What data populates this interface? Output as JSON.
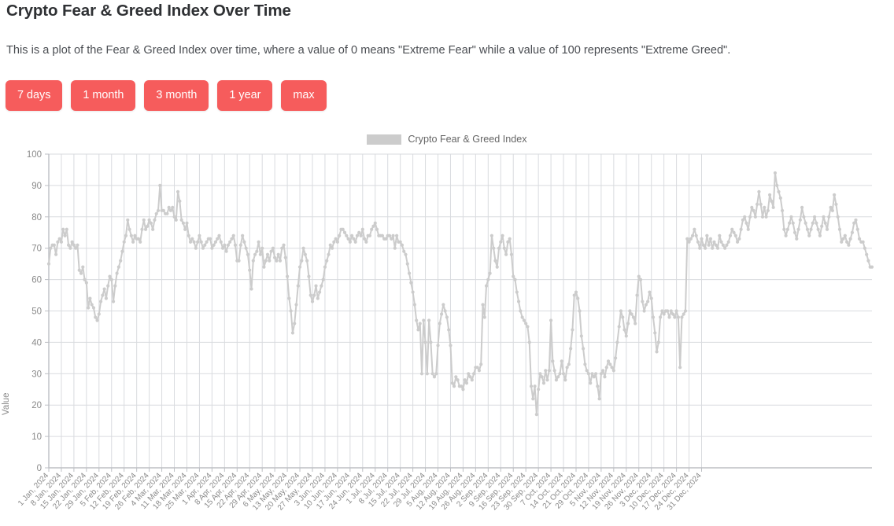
{
  "page": {
    "title": "Crypto Fear & Greed Index Over Time",
    "description": "This is a plot of the Fear & Greed Index over time, where a value of 0 means \"Extreme Fear\" while a value of 100 represents \"Extreme Greed\"."
  },
  "range_buttons": [
    {
      "label": "7 days"
    },
    {
      "label": "1 month"
    },
    {
      "label": "3 month"
    },
    {
      "label": "1 year"
    },
    {
      "label": "max"
    }
  ],
  "colors": {
    "button": "#f65c5c",
    "button_text": "#ffffff",
    "series": "#cccccc",
    "grid": "#d6d8dc",
    "axis_text": "#8a8a8a",
    "title_text": "#2f3134"
  },
  "chart_data": {
    "type": "line",
    "title": "",
    "xlabel": "",
    "ylabel": "Value",
    "ylim": [
      0,
      100
    ],
    "yticks": [
      0,
      10,
      20,
      30,
      40,
      50,
      60,
      70,
      80,
      90,
      100
    ],
    "grid": true,
    "legend_position": "top-center",
    "series": [
      {
        "name": "Crypto Fear & Greed Index",
        "color": "#cccccc",
        "marker": "circle",
        "values": [
          65,
          70,
          71,
          71,
          68,
          72,
          73,
          72,
          76,
          74,
          76,
          71,
          70,
          72,
          71,
          70,
          71,
          63,
          62,
          64,
          60,
          59,
          51,
          54,
          52,
          51,
          48,
          47,
          49,
          53,
          55,
          57,
          54,
          58,
          61,
          60,
          53,
          58,
          62,
          64,
          66,
          69,
          72,
          74,
          79,
          76,
          74,
          72,
          74,
          73,
          73,
          72,
          76,
          79,
          76,
          77,
          79,
          78,
          76,
          79,
          81,
          82,
          90,
          82,
          82,
          81,
          81,
          83,
          82,
          83,
          80,
          79,
          88,
          85,
          79,
          78,
          76,
          78,
          74,
          72,
          73,
          72,
          70,
          72,
          74,
          72,
          70,
          71,
          72,
          73,
          73,
          70,
          71,
          72,
          73,
          74,
          72,
          70,
          71,
          69,
          71,
          72,
          73,
          74,
          71,
          66,
          66,
          71,
          74,
          72,
          70,
          68,
          63,
          57,
          66,
          68,
          69,
          72,
          68,
          70,
          64,
          66,
          68,
          66,
          69,
          70,
          67,
          66,
          68,
          66,
          70,
          71,
          67,
          61,
          54,
          50,
          43,
          46,
          52,
          58,
          64,
          66,
          70,
          68,
          66,
          61,
          55,
          53,
          55,
          58,
          54,
          56,
          58,
          60,
          64,
          66,
          68,
          71,
          70,
          72,
          73,
          72,
          74,
          76,
          76,
          75,
          74,
          73,
          72,
          74,
          73,
          72,
          74,
          75,
          74,
          76,
          73,
          72,
          74,
          74,
          76,
          77,
          78,
          76,
          74,
          74,
          74,
          73,
          73,
          74,
          74,
          73,
          74,
          70,
          74,
          72,
          72,
          71,
          69,
          68,
          65,
          62,
          59,
          56,
          52,
          47,
          44,
          46,
          30,
          47,
          40,
          30,
          47,
          40,
          30,
          29,
          30,
          39,
          46,
          49,
          52,
          50,
          48,
          44,
          39,
          27,
          26,
          29,
          28,
          26,
          26,
          25,
          28,
          27,
          30,
          29,
          28,
          30,
          32,
          32,
          31,
          33,
          52,
          48,
          58,
          60,
          62,
          74,
          70,
          66,
          64,
          70,
          72,
          74,
          70,
          68,
          72,
          73,
          68,
          61,
          60,
          56,
          53,
          50,
          48,
          47,
          46,
          45,
          40,
          26,
          22,
          26,
          17,
          25,
          30,
          29,
          27,
          31,
          28,
          31,
          47,
          34,
          31,
          28,
          29,
          30,
          34,
          30,
          28,
          32,
          33,
          38,
          44,
          55,
          56,
          54,
          50,
          42,
          38,
          33,
          31,
          30,
          27,
          30,
          29,
          30,
          26,
          22,
          30,
          31,
          29,
          32,
          34,
          33,
          32,
          31,
          35,
          40,
          45,
          50,
          48,
          44,
          42,
          46,
          50,
          49,
          48,
          46,
          55,
          61,
          60,
          53,
          50,
          52,
          53,
          56,
          54,
          48,
          43,
          37,
          40,
          48,
          50,
          49,
          50,
          50,
          48,
          50,
          49,
          48,
          50,
          48,
          32,
          48,
          49,
          50,
          73,
          72,
          73,
          74,
          76,
          74,
          72,
          70,
          73,
          71,
          70,
          74,
          71,
          73,
          70,
          72,
          71,
          70,
          74,
          72,
          71,
          70,
          71,
          72,
          74,
          76,
          75,
          74,
          72,
          73,
          76,
          79,
          80,
          78,
          76,
          80,
          83,
          82,
          80,
          84,
          88,
          84,
          80,
          83,
          80,
          82,
          87,
          85,
          83,
          94,
          90,
          88,
          86,
          82,
          76,
          74,
          76,
          78,
          80,
          78,
          75,
          73,
          76,
          79,
          83,
          80,
          78,
          76,
          74,
          76,
          78,
          80,
          78,
          76,
          74,
          77,
          80,
          78,
          76,
          80,
          83,
          82,
          87,
          84,
          80,
          76,
          72,
          73,
          74,
          72,
          71,
          73,
          75,
          78,
          79,
          76,
          73,
          72,
          72,
          70,
          68,
          66,
          64,
          64
        ]
      }
    ],
    "x_tick_labels": [
      "1 Jan, 2024",
      "8 Jan, 2024",
      "15 Jan, 2024",
      "22 Jan, 2024",
      "29 Jan, 2024",
      "5 Feb, 2024",
      "12 Feb, 2024",
      "19 Feb, 2024",
      "26 Feb, 2024",
      "4 Mar, 2024",
      "11 Mar, 2024",
      "18 Mar, 2024",
      "25 Mar, 2024",
      "1 Apr, 2024",
      "8 Apr, 2024",
      "15 Apr, 2024",
      "22 Apr, 2024",
      "29 Apr, 2024",
      "6 May, 2024",
      "13 May, 2024",
      "20 May, 2024",
      "27 May, 2024",
      "3 Jun, 2024",
      "10 Jun, 2024",
      "17 Jun, 2024",
      "24 Jun, 2024",
      "1 Jul, 2024",
      "8 Jul, 2024",
      "15 Jul, 2024",
      "22 Jul, 2024",
      "29 Jul, 2024",
      "5 Aug, 2024",
      "12 Aug, 2024",
      "19 Aug, 2024",
      "26 Aug, 2024",
      "2 Sep, 2024",
      "9 Sep, 2024",
      "16 Sep, 2024",
      "23 Sep, 2024",
      "30 Sep, 2024",
      "7 Oct, 2024",
      "14 Oct, 2024",
      "21 Oct, 2024",
      "29 Oct, 2024",
      "5 Nov, 2024",
      "12 Nov, 2024",
      "19 Nov, 2024",
      "26 Nov, 2024",
      "3 Dec, 2024",
      "10 Dec, 2024",
      "17 Dec, 2024",
      "24 Dec, 2024",
      "31 Dec, 2024"
    ],
    "legend": [
      {
        "label": "Crypto Fear & Greed Index",
        "color": "#cccccc"
      }
    ]
  }
}
